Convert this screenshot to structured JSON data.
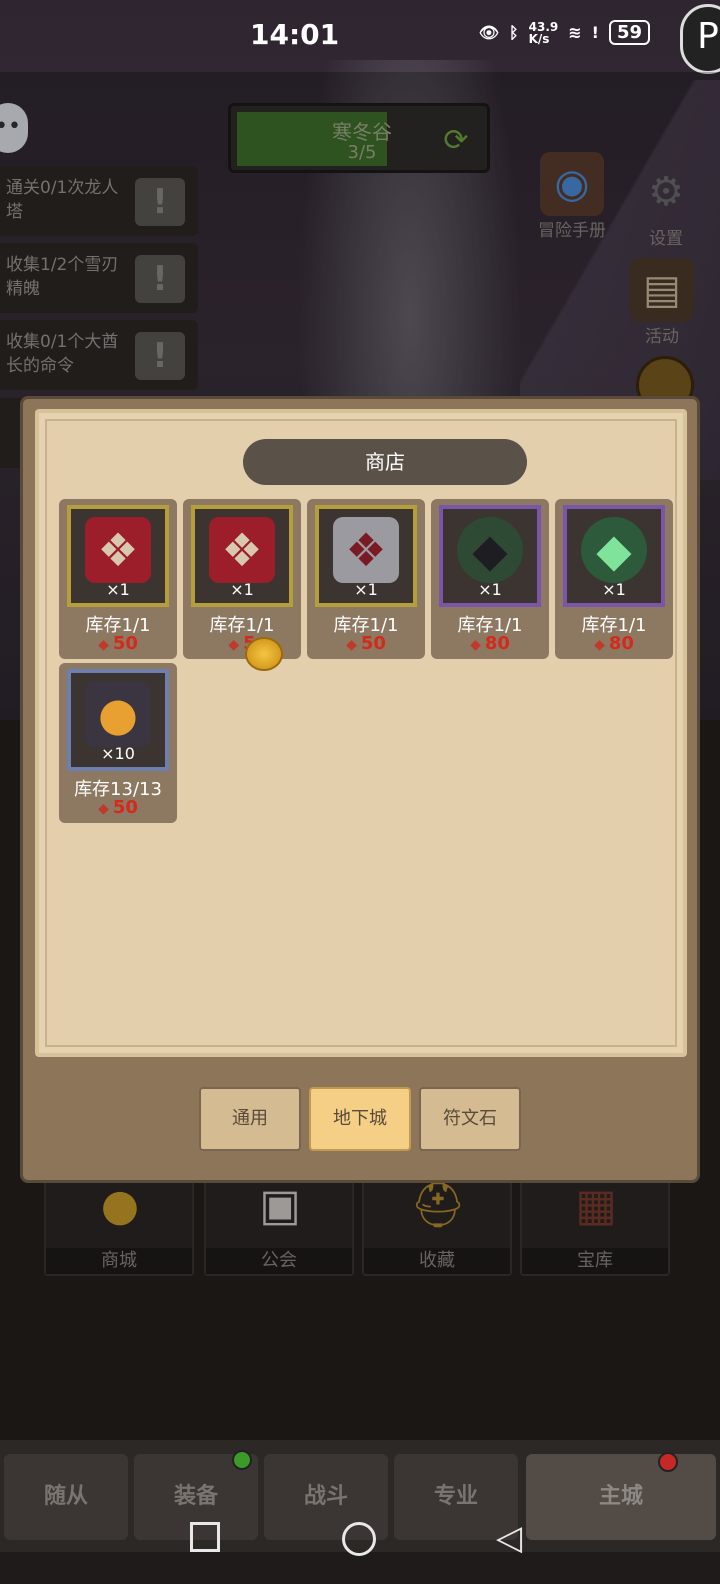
{
  "status_bar": {
    "time": "14:01",
    "net_speed": "43.9\nK/s",
    "battery": "59"
  },
  "level": {
    "name": "寒冬谷",
    "progress": "3/5"
  },
  "quests": [
    {
      "text": "通关0/1次龙人塔"
    },
    {
      "text": "收集1/2个雪刃精魄"
    },
    {
      "text": "收集0/1个大酋长的命令"
    }
  ],
  "right_menu": [
    {
      "label": "冒险手册",
      "icon": "book-icon"
    },
    {
      "label": "设置",
      "icon": "gear-icon"
    },
    {
      "label": "活动",
      "icon": "scroll-icon"
    }
  ],
  "shop": {
    "title": "商店",
    "items": [
      {
        "qty": "×1",
        "stock": "库存1/1",
        "price": "50",
        "icon": "red-book-icon",
        "rarity": "gold"
      },
      {
        "qty": "×1",
        "stock": "库存1/1",
        "price": "5",
        "icon": "red-book-icon",
        "rarity": "gold"
      },
      {
        "qty": "×1",
        "stock": "库存1/1",
        "price": "50",
        "icon": "silver-book-icon",
        "rarity": "gold"
      },
      {
        "qty": "×1",
        "stock": "库存1/1",
        "price": "80",
        "icon": "dark-dragon-icon",
        "rarity": "purple"
      },
      {
        "qty": "×1",
        "stock": "库存1/1",
        "price": "80",
        "icon": "green-dragon-icon",
        "rarity": "purple"
      },
      {
        "qty": "×10",
        "stock": "库存13/13",
        "price": "50",
        "icon": "dark-stone-icon",
        "rarity": "blue"
      }
    ],
    "tabs": [
      {
        "label": "通用",
        "active": false
      },
      {
        "label": "地下城",
        "active": true
      },
      {
        "label": "符文石",
        "active": false
      }
    ]
  },
  "city": [
    {
      "label": "商城",
      "icon": "crown-coin-icon"
    },
    {
      "label": "公会",
      "icon": "guild-icon"
    },
    {
      "label": "收藏",
      "icon": "helmet-icon"
    },
    {
      "label": "宝库",
      "icon": "vault-icon"
    }
  ],
  "bottom_nav": [
    {
      "label": "随从"
    },
    {
      "label": "装备"
    },
    {
      "label": "战斗"
    },
    {
      "label": "专业"
    },
    {
      "label": "主城"
    }
  ],
  "colors": {
    "accent_gold": "#f4cf85",
    "price_red": "#d42a1e",
    "badge_green": "#3c9a2a",
    "badge_red": "#c62828"
  }
}
